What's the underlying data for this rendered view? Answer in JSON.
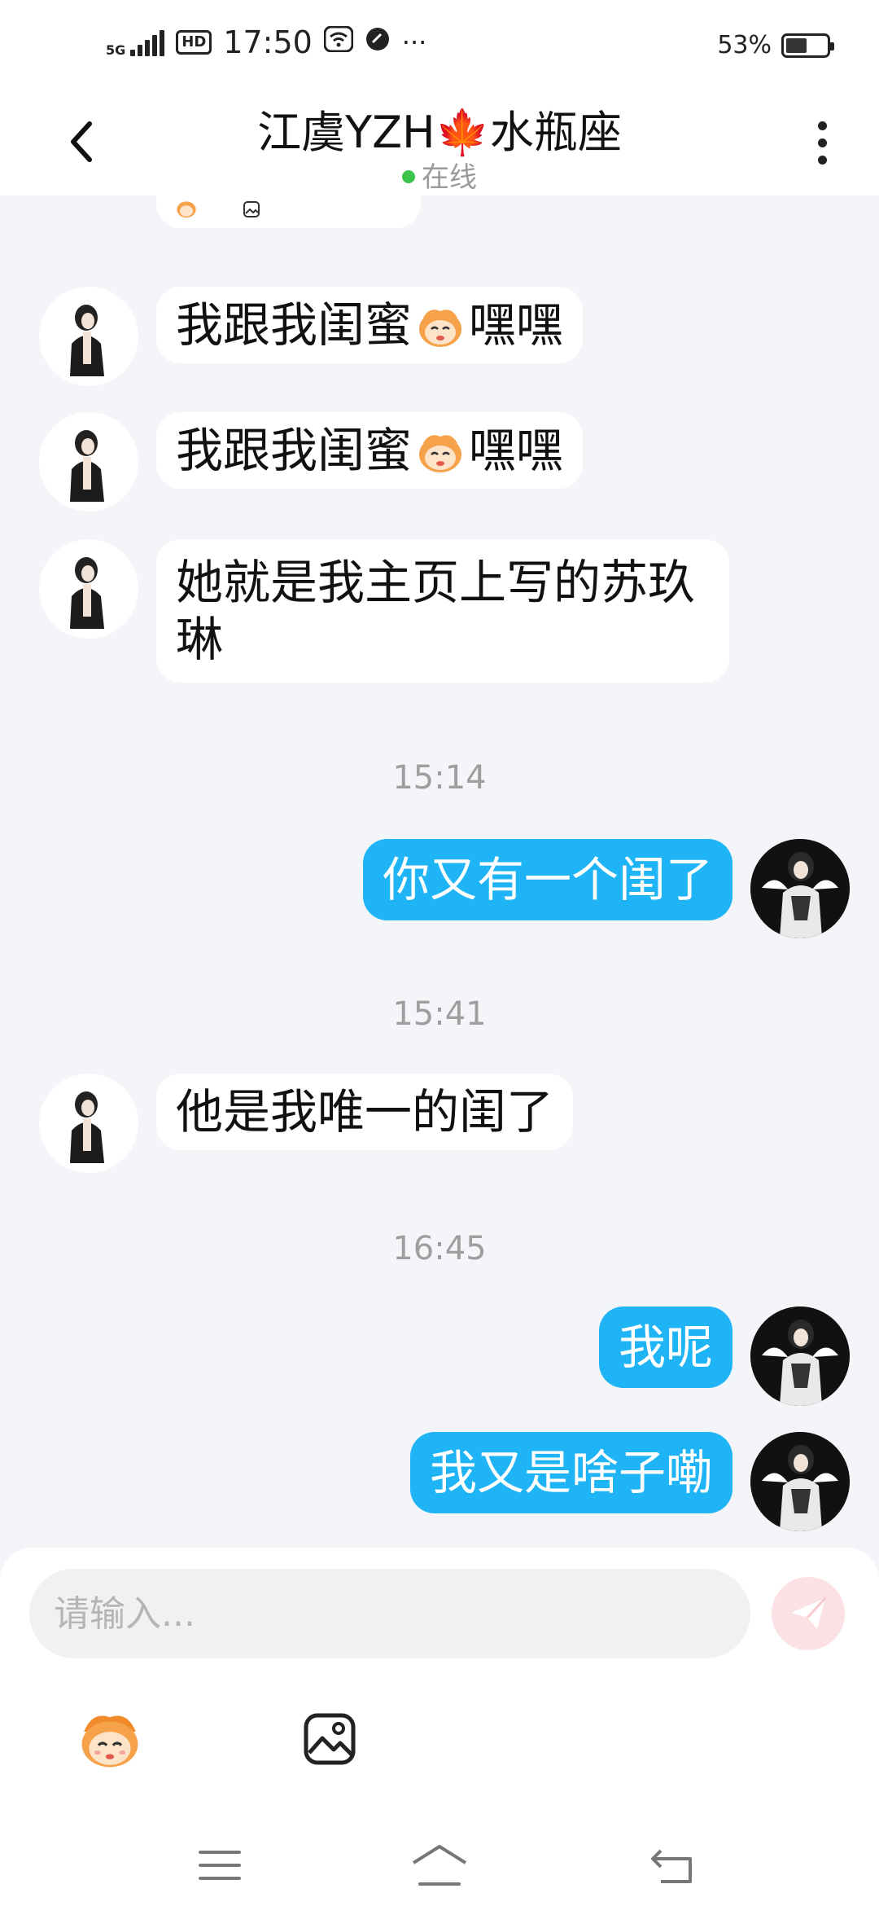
{
  "status_bar": {
    "network": "5G",
    "hd": "HD",
    "time": "17:50",
    "more": "···",
    "battery": "53%",
    "battery_level": 0.53
  },
  "header": {
    "title": "江虞YZH🍁水瓶座",
    "status": "在线"
  },
  "messages": [
    {
      "side": "left",
      "parts": [
        "我跟我闺蜜",
        "[emoji]",
        "嘿嘿"
      ]
    },
    {
      "side": "left",
      "parts": [
        "我跟我闺蜜",
        "[emoji]",
        "嘿嘿"
      ]
    },
    {
      "side": "left",
      "text": "她就是我主页上写的苏玖琳"
    },
    {
      "timestamp": "15:14"
    },
    {
      "side": "right",
      "text": "你又有一个闺了"
    },
    {
      "timestamp": "15:41"
    },
    {
      "side": "left",
      "text": "他是我唯一的闺了"
    },
    {
      "timestamp": "16:45"
    },
    {
      "side": "right",
      "text": "我呢"
    },
    {
      "side": "right",
      "text": "我又是啥子嘞"
    }
  ],
  "composer": {
    "placeholder": "请输入..."
  },
  "colors": {
    "self_bubble": "#1eb4f5",
    "other_bubble": "#ffffff",
    "online": "#3cc54a",
    "send_button": "#fbe1e3"
  },
  "icons": [
    "back-arrow-icon",
    "more-vertical-icon",
    "send-icon",
    "emoji-icon",
    "image-icon",
    "menu-icon",
    "home-icon",
    "back-icon"
  ]
}
